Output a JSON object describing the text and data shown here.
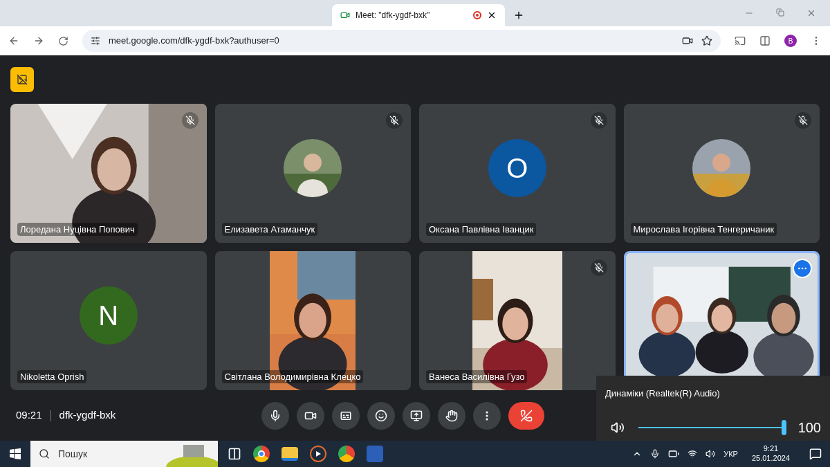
{
  "browser": {
    "tab_title": "Meet: \"dfk-ygdf-bxk\"",
    "url": "meet.google.com/dfk-ygdf-bxk?authuser=0",
    "profile_initial": "B"
  },
  "tiles": [
    {
      "kind": "video",
      "name": "Лоредана Нуцівна Попович",
      "muted": true,
      "selected": false
    },
    {
      "name": "Елизавета Атаманчук",
      "muted": true,
      "selected": false
    },
    {
      "kind": "letter",
      "letter": "O",
      "color": "#0b57a0",
      "name": "Оксана Павлівна Іванцик",
      "muted": true,
      "selected": false
    },
    {
      "name": "Мирослава Ігорівна Тенгеричаник",
      "muted": true,
      "selected": false
    },
    {
      "kind": "letter",
      "letter": "N",
      "color": "#33691e",
      "name": "Nikoletta Oprish",
      "muted": false,
      "selected": false
    },
    {
      "kind": "video-narrow",
      "name": "Світлана Володимирівна Клецко",
      "muted": false,
      "selected": false
    },
    {
      "kind": "video-narrow",
      "name": "Ванеса Василівна Гузо",
      "muted": true,
      "selected": false
    },
    {
      "kind": "group",
      "muted": false,
      "selected": true
    }
  ],
  "meeting": {
    "time": "09:21",
    "code": "dfk-ygdf-bxk"
  },
  "volume": {
    "device": "Динаміки (Realtek(R) Audio)",
    "level": 1,
    "reading": "100"
  },
  "taskbar": {
    "search_placeholder": "Пошук",
    "language": "УКР",
    "time": "9:21",
    "date": "25.01.2024"
  }
}
